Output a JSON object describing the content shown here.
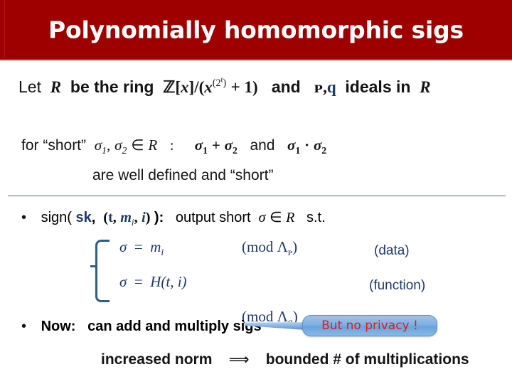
{
  "slide": {
    "title": "Polynomially homomorphic sigs",
    "title_bar_color": "#9e0000",
    "title_text_color": "#ffffff",
    "accent_navy": "#1f3864",
    "accent_red": "#e01b1b",
    "divider_color": "#4a6a72"
  },
  "line1": {
    "lead": "Let",
    "ring_var": "R",
    "mid": "be the ring",
    "ring_Z": "ℤ",
    "bracket_open": "[",
    "poly_var": "x",
    "bracket_close": "]",
    "quotient": "/(",
    "poly_var2": "x",
    "exp_open": "(2",
    "exp_ell": "ℓ",
    "exp_close": ")",
    "plus_one": "+ 1)",
    "and": "and",
    "ideal_p": "ᴩ",
    "comma": ",",
    "ideal_q": "q",
    "tail": "ideals in",
    "tail_var": "R"
  },
  "line2": {
    "lead": "for “short”",
    "sigma1": "σ",
    "sub1": "1",
    "comma": ",",
    "sigma2": "σ",
    "sub2": "2",
    "member": "∈",
    "ring": "R",
    "colon": ":",
    "sum_s1": "σ",
    "sum_sub1": "1",
    "plus": "+",
    "sum_s2": "σ",
    "sum_sub2": "2",
    "and": "and",
    "prod_s1": "σ",
    "prod_sub1": "1",
    "dot": "·",
    "prod_s2": "σ",
    "prod_sub2": "2"
  },
  "line3": {
    "text": "are well defined and “short”"
  },
  "bullet1": {
    "dot": "•",
    "sign_label": "sign(",
    "sk": "sk",
    "comma1": ",",
    "paren_open": "(",
    "t": "t",
    "comma2": ",",
    "m": "m",
    "m_sub": "i",
    "comma3": ",",
    "i": "i",
    "paren_close": ")",
    "close": "):",
    "output": "output short",
    "sigma": "σ",
    "member": "∈",
    "ring": "R",
    "st": "s.t."
  },
  "equations": {
    "row1": {
      "sigma": "σ",
      "eq": "=",
      "rhs": "m",
      "rhs_sub": "i",
      "mod": "(mod Λ",
      "mod_sub": "ᴩ",
      "mod_close": ")",
      "tag": "(data)"
    },
    "row2": {
      "sigma": "σ",
      "eq": "=",
      "rhs": "H(t, i)",
      "mod": "(mod Λ",
      "mod_sub": "q",
      "mod_close": ")",
      "tag": "(function)"
    }
  },
  "bullet2": {
    "dot": "•",
    "label": "Now:",
    "text": "can add and multiply sigs"
  },
  "callout": {
    "text": "But no privacy !",
    "fill_color": "#7fb0e2",
    "border_color": "#5b92cf",
    "text_color": "#e01b1b"
  },
  "bottom": {
    "left": "increased norm",
    "arrow": "⟹",
    "right": "bounded # of multiplications"
  }
}
